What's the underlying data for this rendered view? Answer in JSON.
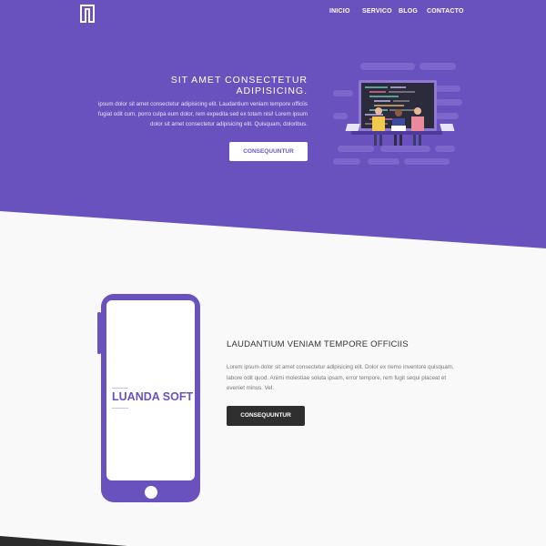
{
  "nav": {
    "items": [
      "INICIO",
      "SERVICO",
      "BLOG",
      "CONTACTO"
    ]
  },
  "hero": {
    "title": "SIT AMET CONSECTETUR ADIPISICING.",
    "text": "ipsum dolor sit amet consectetur adipisicing elit. Laudantium veniam tempore officiis fugiat odit cum, porro culpa eum dolor, rem expedita sed ex totam nisi! Lorem ipsum dolor sit amet consectetur adipisicing elit. Quisquam, doloribus.",
    "button": "CONSEQUUNTUR"
  },
  "about": {
    "brand": "LUANDA SOFT",
    "title": "LAUDANTIUM VENIAM TEMPORE OFFICIIS",
    "text": "Lorem ipsum dolor sit amet consectetur adipisicing elit. Dolor ex nemo inventore quisquam, labore odit quod. Animi molestiae soluta ipsam, error tempore, rem fugit sequi placeat et eveniet minus. Vel.",
    "button": "CONSEQUUNTUR"
  },
  "colors": {
    "brand_purple": "#6a52be",
    "background": "#f9f9f9",
    "dark_button": "#2f2f2f"
  }
}
